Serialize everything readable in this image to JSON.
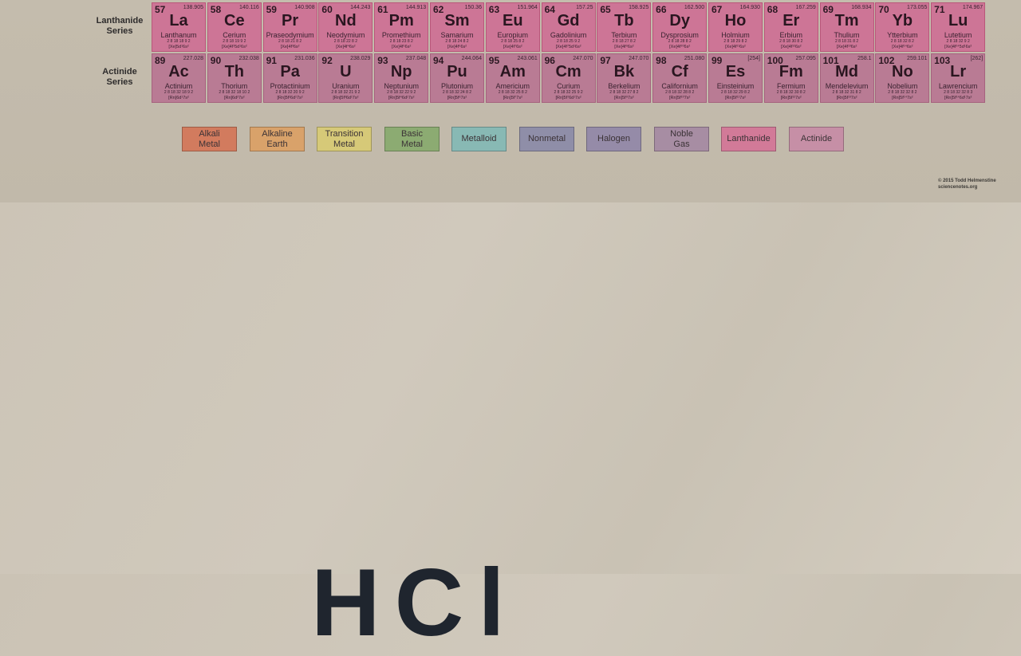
{
  "series_labels": {
    "lanthanide": "Lanthanide\nSeries",
    "actinide": "Actinide\nSeries"
  },
  "lanthanides": [
    {
      "num": "57",
      "mass": "138.905",
      "sym": "La",
      "name": "Lanthanum",
      "shell": "2 8 18 18 9 2",
      "conf": "[Xe]5d¹6s²"
    },
    {
      "num": "58",
      "mass": "140.116",
      "sym": "Ce",
      "name": "Cerium",
      "shell": "2 8 18 19 9 2",
      "conf": "[Xe]4f¹5d¹6s²"
    },
    {
      "num": "59",
      "mass": "140.908",
      "sym": "Pr",
      "name": "Praseodymium",
      "shell": "2 8 18 21 8 2",
      "conf": "[Xe]4f³6s²"
    },
    {
      "num": "60",
      "mass": "144.243",
      "sym": "Nd",
      "name": "Neodymium",
      "shell": "2 8 18 22 8 2",
      "conf": "[Xe]4f⁴6s²"
    },
    {
      "num": "61",
      "mass": "144.913",
      "sym": "Pm",
      "name": "Promethium",
      "shell": "2 8 18 23 8 2",
      "conf": "[Xe]4f⁵6s²"
    },
    {
      "num": "62",
      "mass": "150.36",
      "sym": "Sm",
      "name": "Samarium",
      "shell": "2 8 18 24 8 2",
      "conf": "[Xe]4f⁶6s²"
    },
    {
      "num": "63",
      "mass": "151.964",
      "sym": "Eu",
      "name": "Europium",
      "shell": "2 8 18 25 8 2",
      "conf": "[Xe]4f⁷6s²"
    },
    {
      "num": "64",
      "mass": "157.25",
      "sym": "Gd",
      "name": "Gadolinium",
      "shell": "2 8 18 25 9 2",
      "conf": "[Xe]4f⁷5d¹6s²"
    },
    {
      "num": "65",
      "mass": "158.925",
      "sym": "Tb",
      "name": "Terbium",
      "shell": "2 8 18 27 8 2",
      "conf": "[Xe]4f⁹6s²"
    },
    {
      "num": "66",
      "mass": "162.500",
      "sym": "Dy",
      "name": "Dysprosium",
      "shell": "2 8 18 28 8 2",
      "conf": "[Xe]4f¹⁰6s²"
    },
    {
      "num": "67",
      "mass": "164.930",
      "sym": "Ho",
      "name": "Holmium",
      "shell": "2 8 18 29 8 2",
      "conf": "[Xe]4f¹¹6s²"
    },
    {
      "num": "68",
      "mass": "167.259",
      "sym": "Er",
      "name": "Erbium",
      "shell": "2 8 18 30 8 2",
      "conf": "[Xe]4f¹²6s²"
    },
    {
      "num": "69",
      "mass": "168.934",
      "sym": "Tm",
      "name": "Thulium",
      "shell": "2 8 18 31 8 2",
      "conf": "[Xe]4f¹³6s²"
    },
    {
      "num": "70",
      "mass": "173.055",
      "sym": "Yb",
      "name": "Ytterbium",
      "shell": "2 8 18 32 8 2",
      "conf": "[Xe]4f¹⁴6s²"
    },
    {
      "num": "71",
      "mass": "174.967",
      "sym": "Lu",
      "name": "Lutetium",
      "shell": "2 8 18 32 9 2",
      "conf": "[Xe]4f¹⁴5d¹6s²"
    }
  ],
  "actinides": [
    {
      "num": "89",
      "mass": "227.028",
      "sym": "Ac",
      "name": "Actinium",
      "shell": "2 8 18 32 18 9 2",
      "conf": "[Rn]6d¹7s²"
    },
    {
      "num": "90",
      "mass": "232.038",
      "sym": "Th",
      "name": "Thorium",
      "shell": "2 8 18 32 18 10 2",
      "conf": "[Rn]6d²7s²"
    },
    {
      "num": "91",
      "mass": "231.036",
      "sym": "Pa",
      "name": "Protactinium",
      "shell": "2 8 18 32 20 9 2",
      "conf": "[Rn]5f²6d¹7s²"
    },
    {
      "num": "92",
      "mass": "238.029",
      "sym": "U",
      "name": "Uranium",
      "shell": "2 8 18 32 21 9 2",
      "conf": "[Rn]5f³6d¹7s²"
    },
    {
      "num": "93",
      "mass": "237.048",
      "sym": "Np",
      "name": "Neptunium",
      "shell": "2 8 18 32 22 9 2",
      "conf": "[Rn]5f⁴6d¹7s²"
    },
    {
      "num": "94",
      "mass": "244.064",
      "sym": "Pu",
      "name": "Plutonium",
      "shell": "2 8 18 32 24 8 2",
      "conf": "[Rn]5f⁶7s²"
    },
    {
      "num": "95",
      "mass": "243.061",
      "sym": "Am",
      "name": "Americium",
      "shell": "2 8 18 32 25 8 2",
      "conf": "[Rn]5f⁷7s²"
    },
    {
      "num": "96",
      "mass": "247.070",
      "sym": "Cm",
      "name": "Curium",
      "shell": "2 8 18 32 25 9 2",
      "conf": "[Rn]5f⁷6d¹7s²"
    },
    {
      "num": "97",
      "mass": "247.070",
      "sym": "Bk",
      "name": "Berkelium",
      "shell": "2 8 18 32 27 8 2",
      "conf": "[Rn]5f⁹7s²"
    },
    {
      "num": "98",
      "mass": "251.080",
      "sym": "Cf",
      "name": "Californium",
      "shell": "2 8 18 32 28 8 2",
      "conf": "[Rn]5f¹⁰7s²"
    },
    {
      "num": "99",
      "mass": "[254]",
      "sym": "Es",
      "name": "Einsteinium",
      "shell": "2 8 18 32 29 8 2",
      "conf": "[Rn]5f¹¹7s²"
    },
    {
      "num": "100",
      "mass": "257.095",
      "sym": "Fm",
      "name": "Fermium",
      "shell": "2 8 18 32 30 8 2",
      "conf": "[Rn]5f¹²7s²"
    },
    {
      "num": "101",
      "mass": "258.1",
      "sym": "Md",
      "name": "Mendelevium",
      "shell": "2 8 18 32 31 8 2",
      "conf": "[Rn]5f¹³7s²"
    },
    {
      "num": "102",
      "mass": "259.101",
      "sym": "No",
      "name": "Nobelium",
      "shell": "2 8 18 32 32 8 2",
      "conf": "[Rn]5f¹⁴7s²"
    },
    {
      "num": "103",
      "mass": "[262]",
      "sym": "Lr",
      "name": "Lawrencium",
      "shell": "2 8 18 32 32 8 3",
      "conf": "[Rn]5f¹⁴6d¹7s²"
    }
  ],
  "legend": [
    {
      "label": "Alkali\nMetal",
      "color": "#d27b5e"
    },
    {
      "label": "Alkaline\nEarth",
      "color": "#d9a26a"
    },
    {
      "label": "Transition\nMetal",
      "color": "#d6c978"
    },
    {
      "label": "Basic\nMetal",
      "color": "#8cab72"
    },
    {
      "label": "Metalloid",
      "color": "#88b9b4"
    },
    {
      "label": "Nonmetal",
      "color": "#8f8ea8"
    },
    {
      "label": "Halogen",
      "color": "#958ba8"
    },
    {
      "label": "Noble\nGas",
      "color": "#a78da3"
    },
    {
      "label": "Lanthanide",
      "color": "#d27a98"
    },
    {
      "label": "Actinide",
      "color": "#c68fa6"
    }
  ],
  "copyright": {
    "line1": "© 2015 Todd Helmenstine",
    "line2": "sciencenotes.org"
  },
  "big_text": "HCl"
}
